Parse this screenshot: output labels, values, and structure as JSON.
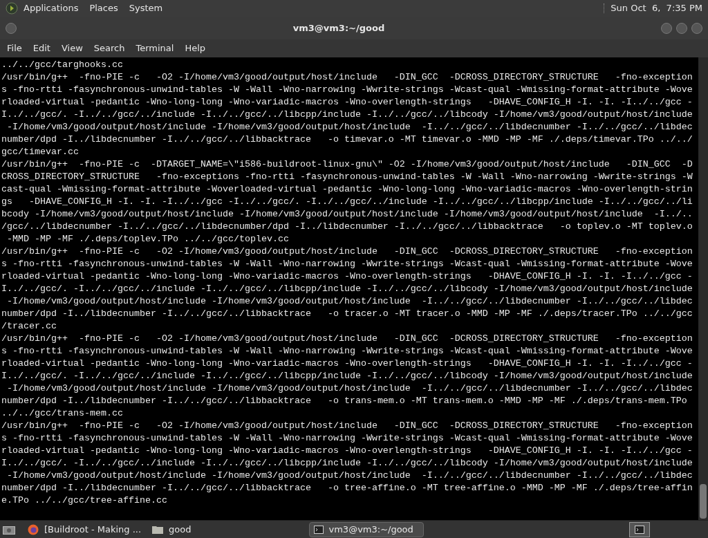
{
  "top_panel": {
    "menus": [
      "Applications",
      "Places",
      "System"
    ],
    "clock": "Sun Oct  6,  7:35 PM"
  },
  "window": {
    "title": "vm3@vm3:~/good",
    "menu": [
      "File",
      "Edit",
      "View",
      "Search",
      "Terminal",
      "Help"
    ],
    "lines": [
      "../../gcc/targhooks.cc",
      "/usr/bin/g++  -fno-PIE -c   -O2 -I/home/vm3/good/output/host/include   -DIN_GCC  -DCROSS_DIRECTORY_STRUCTURE   -fno-exception",
      "s -fno-rtti -fasynchronous-unwind-tables -W -Wall -Wno-narrowing -Wwrite-strings -Wcast-qual -Wmissing-format-attribute -Wove",
      "rloaded-virtual -pedantic -Wno-long-long -Wno-variadic-macros -Wno-overlength-strings   -DHAVE_CONFIG_H -I. -I. -I../../gcc -",
      "I../../gcc/. -I../../gcc/../include -I../../gcc/../libcpp/include -I../../gcc/../libcody -I/home/vm3/good/output/host/include",
      " -I/home/vm3/good/output/host/include -I/home/vm3/good/output/host/include  -I../../gcc/../libdecnumber -I../../gcc/../libdec",
      "number/dpd -I../libdecnumber -I../../gcc/../libbacktrace   -o timevar.o -MT timevar.o -MMD -MP -MF ./.deps/timevar.TPo ../../",
      "gcc/timevar.cc",
      "/usr/bin/g++  -fno-PIE -c  -DTARGET_NAME=\\\"i586-buildroot-linux-gnu\\\" -O2 -I/home/vm3/good/output/host/include   -DIN_GCC  -D",
      "CROSS_DIRECTORY_STRUCTURE   -fno-exceptions -fno-rtti -fasynchronous-unwind-tables -W -Wall -Wno-narrowing -Wwrite-strings -W",
      "cast-qual -Wmissing-format-attribute -Woverloaded-virtual -pedantic -Wno-long-long -Wno-variadic-macros -Wno-overlength-strin",
      "gs   -DHAVE_CONFIG_H -I. -I. -I../../gcc -I../../gcc/. -I../../gcc/../include -I../../gcc/../libcpp/include -I../../gcc/../li",
      "bcody -I/home/vm3/good/output/host/include -I/home/vm3/good/output/host/include -I/home/vm3/good/output/host/include  -I../..",
      "/gcc/../libdecnumber -I../../gcc/../libdecnumber/dpd -I../libdecnumber -I../../gcc/../libbacktrace   -o toplev.o -MT toplev.o",
      " -MMD -MP -MF ./.deps/toplev.TPo ../../gcc/toplev.cc",
      "/usr/bin/g++  -fno-PIE -c   -O2 -I/home/vm3/good/output/host/include   -DIN_GCC  -DCROSS_DIRECTORY_STRUCTURE   -fno-exception",
      "s -fno-rtti -fasynchronous-unwind-tables -W -Wall -Wno-narrowing -Wwrite-strings -Wcast-qual -Wmissing-format-attribute -Wove",
      "rloaded-virtual -pedantic -Wno-long-long -Wno-variadic-macros -Wno-overlength-strings   -DHAVE_CONFIG_H -I. -I. -I../../gcc -",
      "I../../gcc/. -I../../gcc/../include -I../../gcc/../libcpp/include -I../../gcc/../libcody -I/home/vm3/good/output/host/include",
      " -I/home/vm3/good/output/host/include -I/home/vm3/good/output/host/include  -I../../gcc/../libdecnumber -I../../gcc/../libdec",
      "number/dpd -I../libdecnumber -I../../gcc/../libbacktrace   -o tracer.o -MT tracer.o -MMD -MP -MF ./.deps/tracer.TPo ../../gcc",
      "/tracer.cc",
      "/usr/bin/g++  -fno-PIE -c   -O2 -I/home/vm3/good/output/host/include   -DIN_GCC  -DCROSS_DIRECTORY_STRUCTURE   -fno-exception",
      "s -fno-rtti -fasynchronous-unwind-tables -W -Wall -Wno-narrowing -Wwrite-strings -Wcast-qual -Wmissing-format-attribute -Wove",
      "rloaded-virtual -pedantic -Wno-long-long -Wno-variadic-macros -Wno-overlength-strings   -DHAVE_CONFIG_H -I. -I. -I../../gcc -",
      "I../../gcc/. -I../../gcc/../include -I../../gcc/../libcpp/include -I../../gcc/../libcody -I/home/vm3/good/output/host/include",
      " -I/home/vm3/good/output/host/include -I/home/vm3/good/output/host/include  -I../../gcc/../libdecnumber -I../../gcc/../libdec",
      "number/dpd -I../libdecnumber -I../../gcc/../libbacktrace   -o trans-mem.o -MT trans-mem.o -MMD -MP -MF ./.deps/trans-mem.TPo",
      "../../gcc/trans-mem.cc",
      "/usr/bin/g++  -fno-PIE -c   -O2 -I/home/vm3/good/output/host/include   -DIN_GCC  -DCROSS_DIRECTORY_STRUCTURE   -fno-exception",
      "s -fno-rtti -fasynchronous-unwind-tables -W -Wall -Wno-narrowing -Wwrite-strings -Wcast-qual -Wmissing-format-attribute -Wove",
      "rloaded-virtual -pedantic -Wno-long-long -Wno-variadic-macros -Wno-overlength-strings   -DHAVE_CONFIG_H -I. -I. -I../../gcc -",
      "I../../gcc/. -I../../gcc/../include -I../../gcc/../libcpp/include -I../../gcc/../libcody -I/home/vm3/good/output/host/include",
      " -I/home/vm3/good/output/host/include -I/home/vm3/good/output/host/include  -I../../gcc/../libdecnumber -I../../gcc/../libdec",
      "number/dpd -I../libdecnumber -I../../gcc/../libbacktrace   -o tree-affine.o -MT tree-affine.o -MMD -MP -MF ./.deps/tree-affin",
      "e.TPo ../../gcc/tree-affine.cc"
    ]
  },
  "taskbar": {
    "items": [
      {
        "kind": "browser",
        "label": "[Buildroot - Making ...",
        "selected": false
      },
      {
        "kind": "folder",
        "label": "good",
        "selected": false
      },
      {
        "kind": "terminal",
        "label": "vm3@vm3:~/good",
        "selected": true
      }
    ]
  }
}
